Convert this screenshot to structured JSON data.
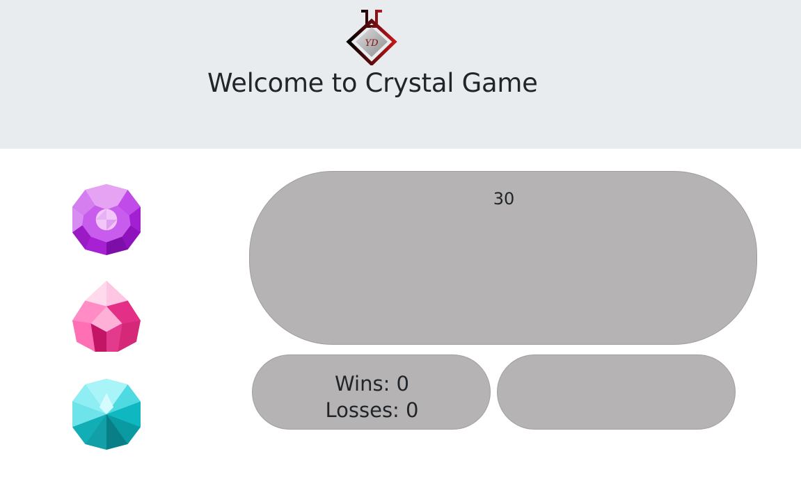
{
  "header": {
    "logo_icon": "yd-flask-logo-icon",
    "logo_letters": "YD",
    "title": "Welcome to Crystal Game"
  },
  "crystals": [
    {
      "icon": "purple-crystal-icon",
      "color": "#a51fd6"
    },
    {
      "icon": "pink-crystal-icon",
      "color": "#ee3f9b"
    },
    {
      "icon": "cyan-crystal-icon",
      "color": "#13c8cf"
    }
  ],
  "game": {
    "target_number": "30",
    "wins_label": "Wins: 0",
    "losses_label": "Losses: 0",
    "total_score": ""
  },
  "colors": {
    "header_bg": "#e9ecef",
    "panel_bg": "#b5b3b4"
  }
}
